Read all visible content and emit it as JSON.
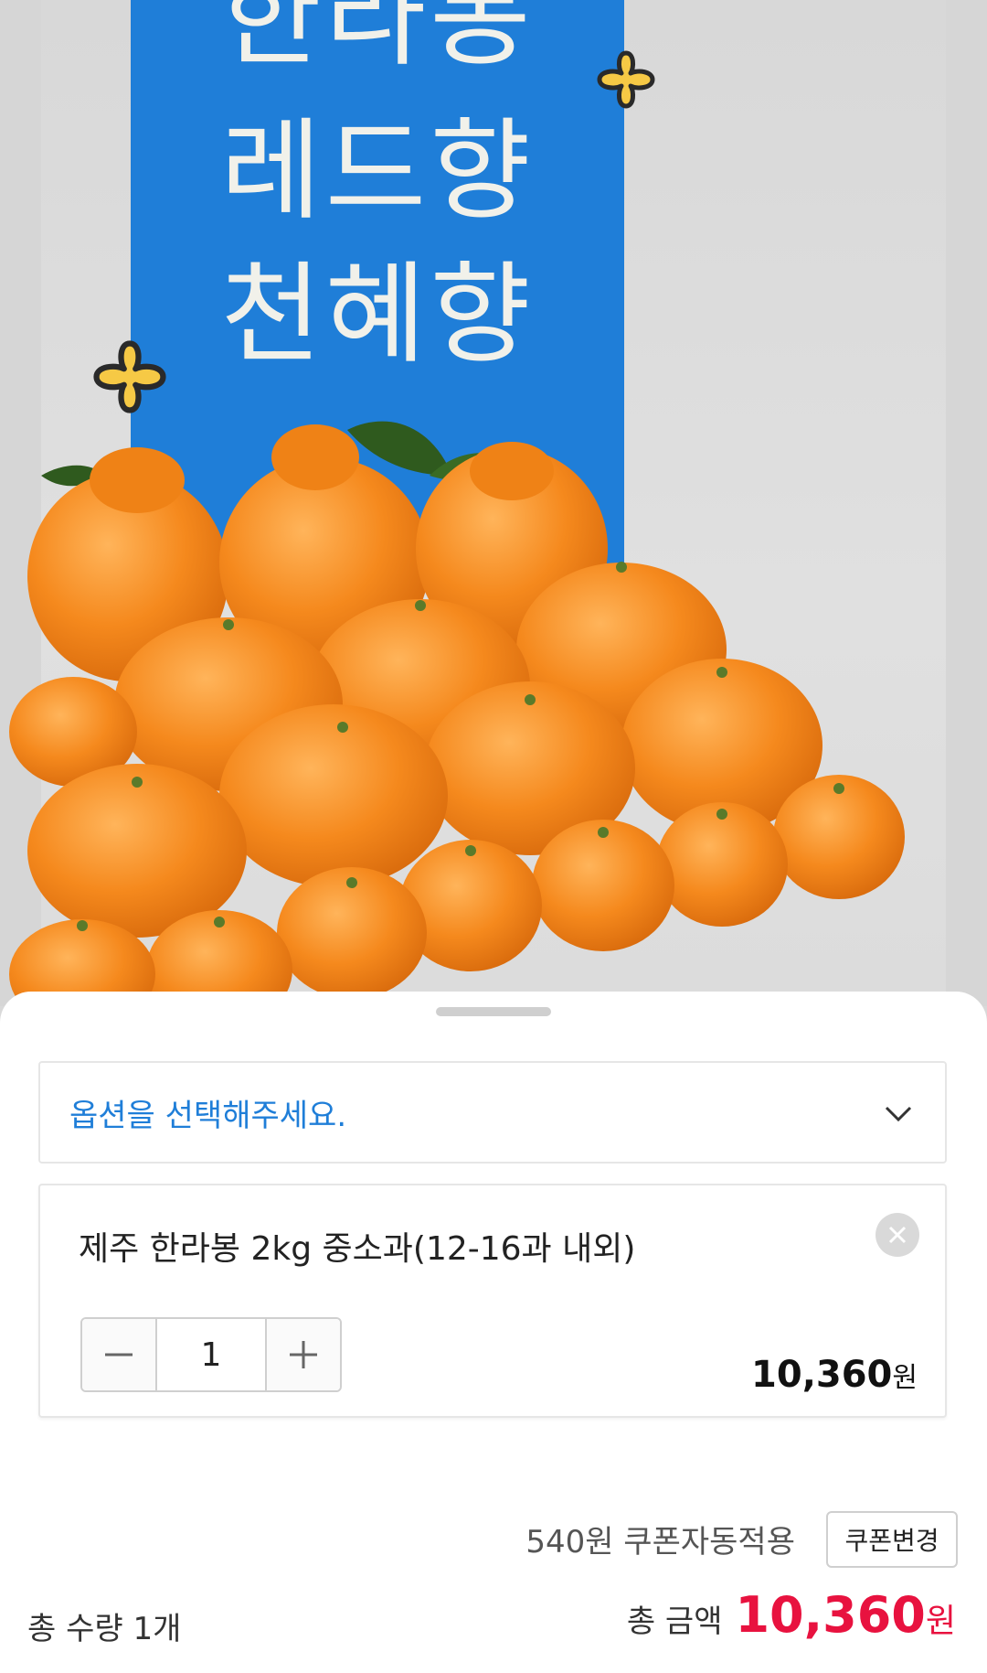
{
  "hero": {
    "banner_lines": [
      "한라봉",
      "레드향",
      "천혜향"
    ],
    "colors": {
      "banner": "#1f7ed8",
      "orange": "#f08a1e",
      "deco": "#f6c945"
    }
  },
  "sheet": {
    "option_placeholder": "옵션을 선택해주세요.",
    "item": {
      "name": "제주 한라봉 2kg 중소과(12-16과 내외)",
      "quantity": "1",
      "price": "10,360",
      "currency": "원"
    },
    "coupon": {
      "text": "540원 쿠폰자동적용",
      "button_label": "쿠폰변경"
    },
    "totals": {
      "quantity_text": "총 수량 1개",
      "amount_label": "총 금액",
      "amount": "10,360",
      "currency": "원"
    },
    "colors": {
      "accent": "#1f7ed8",
      "price_red": "#e8123f"
    },
    "icons": [
      "chevron-down-icon",
      "close-icon",
      "minus-icon",
      "plus-icon"
    ]
  }
}
